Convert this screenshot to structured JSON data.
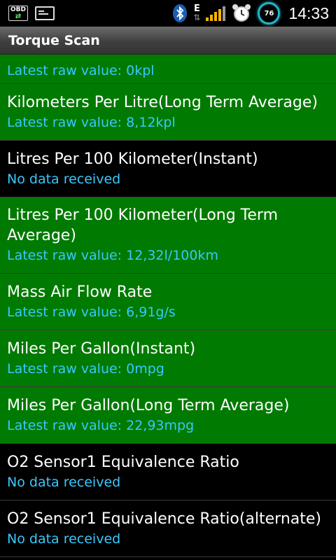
{
  "statusbar": {
    "obd_icon_label": "OBD",
    "data_letter": "E",
    "battery_level": "76",
    "time": "14:33"
  },
  "app": {
    "title": "Torque Scan"
  },
  "rows": [
    {
      "name": "",
      "value": "Latest raw value: 0kpl",
      "state": "green"
    },
    {
      "name": "Kilometers Per Litre(Long Term Average)",
      "value": "Latest raw value: 8,12kpl",
      "state": "green"
    },
    {
      "name": "Litres Per 100 Kilometer(Instant)",
      "value": "No data received",
      "state": "black"
    },
    {
      "name": "Litres Per 100 Kilometer(Long Term Average)",
      "value": "Latest raw value: 12,32l/100km",
      "state": "green"
    },
    {
      "name": "Mass Air Flow Rate",
      "value": "Latest raw value: 6,91g/s",
      "state": "green"
    },
    {
      "name": "Miles Per Gallon(Instant)",
      "value": "Latest raw value: 0mpg",
      "state": "green"
    },
    {
      "name": "Miles Per Gallon(Long Term Average)",
      "value": "Latest raw value: 22,93mpg",
      "state": "green"
    },
    {
      "name": "O2 Sensor1 Equivalence Ratio",
      "value": "No data received",
      "state": "black"
    },
    {
      "name": "O2 Sensor1 Equivalence Ratio(alternate)",
      "value": "No data received",
      "state": "black"
    }
  ],
  "colors": {
    "row_with_data": "#007a00",
    "row_no_data": "#000000",
    "value_text": "#38c8ff",
    "battery_ring": "#1fb6c8",
    "signal_bars": "#f6b400"
  },
  "icons": [
    "obd-icon",
    "sd-card-icon",
    "bluetooth-icon",
    "data-edge-icon",
    "signal-icon",
    "alarm-clock-icon",
    "battery-icon"
  ]
}
